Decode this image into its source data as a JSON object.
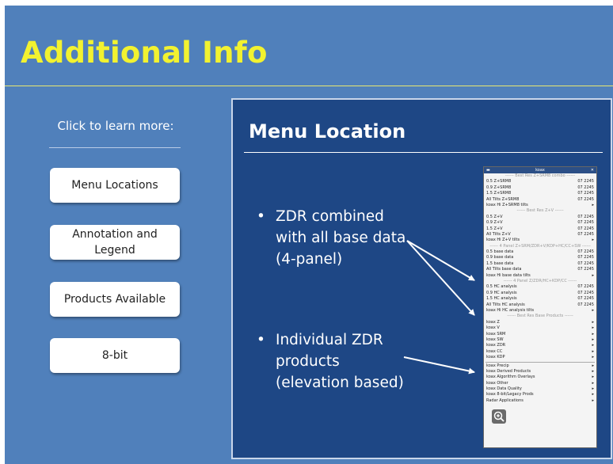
{
  "slide": {
    "title": "Additional Info",
    "click_label": "Click to learn more:",
    "nav": [
      {
        "label": "Menu Locations"
      },
      {
        "label": "Annotation and Legend"
      },
      {
        "label": "Products Available"
      },
      {
        "label": "8-bit"
      }
    ]
  },
  "panel": {
    "title": "Menu Location",
    "bullets": [
      "ZDR combined with all base data (4-panel)",
      "Individual ZDR products (elevation based)"
    ],
    "menu": {
      "window_title": "koax",
      "rows": [
        {
          "text": "------ Best Res Z+SRM8 combo ------",
          "sep": true
        },
        {
          "text": "0.5 Z+SRM8",
          "value": "07 2245"
        },
        {
          "text": "0.9 Z+SRM8",
          "value": "07 2245"
        },
        {
          "text": "1.5 Z+SRM8",
          "value": "07 2245"
        },
        {
          "text": "All Tilts Z+SRM8",
          "value": "07 2245"
        },
        {
          "text": "koax Hi Z+SRM8 tilts",
          "value": "▸"
        },
        {
          "text": "------ Best Res Z+V ------",
          "sep": true
        },
        {
          "text": "0.5 Z+V",
          "value": "07 2245"
        },
        {
          "text": "0.9 Z+V",
          "value": "07 2245"
        },
        {
          "text": "1.5 Z+V",
          "value": "07 2245"
        },
        {
          "text": "All Tilts Z+V",
          "value": "07 2245"
        },
        {
          "text": "koax Hi Z+V tilts",
          "value": "▸"
        },
        {
          "text": "------ 4 Panel Z+SRM/ZDR+V/KDP+HC/CC+SW ------",
          "sep": true
        },
        {
          "text": "0.5 base data",
          "value": "07 2245"
        },
        {
          "text": "0.9 base data",
          "value": "07 2245"
        },
        {
          "text": "1.5 base data",
          "value": "07 2245"
        },
        {
          "text": "All Tilts base data",
          "value": "07 2245"
        },
        {
          "text": "koax Hi base data tilts",
          "value": "▸"
        },
        {
          "text": "------ 4 Panel Z/ZDR/HC+KDP/CC ------",
          "sep": true
        },
        {
          "text": "0.5 HC analysis",
          "value": "07 2245"
        },
        {
          "text": "0.9 HC analysis",
          "value": "07 2245"
        },
        {
          "text": "1.5 HC analysis",
          "value": "07 2245"
        },
        {
          "text": "All Tilts HC analysis",
          "value": "07 2245"
        },
        {
          "text": "koax Hi HC analysis tilts",
          "value": "▸"
        },
        {
          "text": "------ Best Res Base Products ------",
          "sep": true
        },
        {
          "text": "koax Z",
          "value": "▸"
        },
        {
          "text": "koax V",
          "value": "▸"
        },
        {
          "text": "koax SRM",
          "value": "▸"
        },
        {
          "text": "koax SW",
          "value": "▸"
        },
        {
          "text": "koax ZDR",
          "value": "▸"
        },
        {
          "text": "koax CC",
          "value": "▸"
        },
        {
          "text": "koax KDP",
          "value": "▸"
        },
        {
          "text": "",
          "div": true
        },
        {
          "text": "koax Precip",
          "value": "▸"
        },
        {
          "text": "koax Derived Products",
          "value": "▸"
        },
        {
          "text": "koax Algorithm Overlays",
          "value": "▸"
        },
        {
          "text": "koax Other",
          "value": "▸"
        },
        {
          "text": "koax Data Quality",
          "value": "▸"
        },
        {
          "text": "koax 8-bit/Legacy Prods",
          "value": "▸"
        },
        {
          "text": "Radar Applications",
          "value": "▸"
        }
      ]
    }
  }
}
